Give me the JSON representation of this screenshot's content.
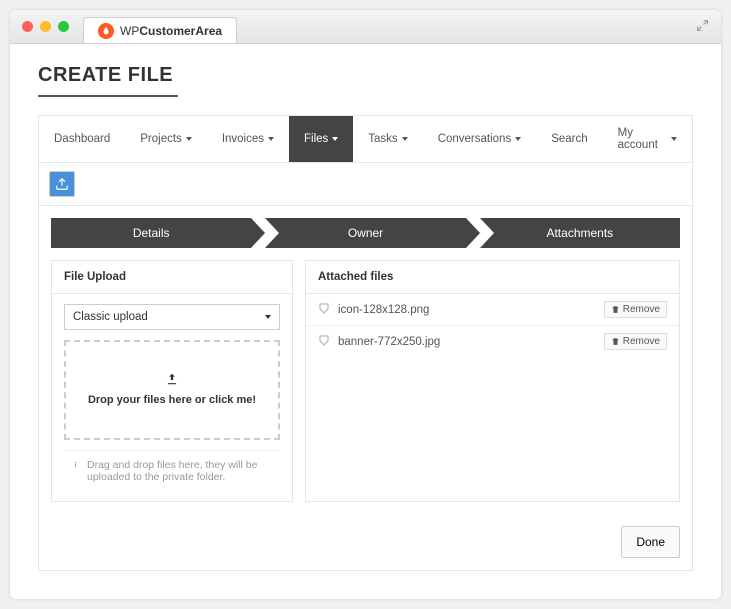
{
  "brand": {
    "prefix": "WP",
    "bold": "CustomerArea"
  },
  "page_title": "CREATE FILE",
  "nav": [
    {
      "label": "Dashboard",
      "dd": false
    },
    {
      "label": "Projects",
      "dd": true
    },
    {
      "label": "Invoices",
      "dd": true
    },
    {
      "label": "Files",
      "dd": true,
      "active": true
    },
    {
      "label": "Tasks",
      "dd": true
    },
    {
      "label": "Conversations",
      "dd": true
    },
    {
      "label": "Search",
      "dd": false
    },
    {
      "label": "My account",
      "dd": true
    }
  ],
  "steps": [
    "Details",
    "Owner",
    "Attachments"
  ],
  "upload": {
    "heading": "File Upload",
    "select_label": "Classic upload",
    "drop_text": "Drop your files here or click me!",
    "hint": "Drag and drop files here, they will be uploaded to the private folder."
  },
  "attached": {
    "heading": "Attached files",
    "files": [
      {
        "name": "icon-128x128.png"
      },
      {
        "name": "banner-772x250.jpg"
      }
    ],
    "remove_label": "Remove"
  },
  "done_label": "Done"
}
